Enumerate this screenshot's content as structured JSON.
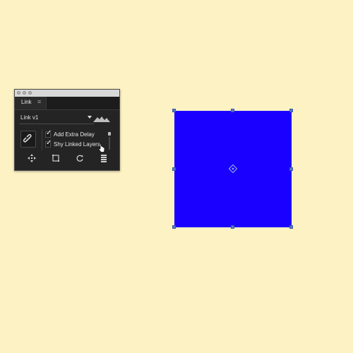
{
  "panel": {
    "tab_label": "Link",
    "tab_menu_glyph": "≡",
    "preset_value": "Link v1",
    "preset_dropdown_icon": "triangle-down",
    "graph_icon": "mountain-graph-icon",
    "link_icon": "chain-link-icon",
    "options": [
      {
        "label": "Add Extra Delay",
        "checked": true
      },
      {
        "label": "Shy Linked Layers",
        "checked": true
      }
    ],
    "bottom_icons": [
      "move-icon",
      "bounding-box-icon",
      "rotate-icon",
      "stack-icon"
    ]
  },
  "canvas": {
    "shape_fill": "#1a00ff",
    "handle_color": "#5b78c8",
    "background": "#fdf2c4"
  }
}
